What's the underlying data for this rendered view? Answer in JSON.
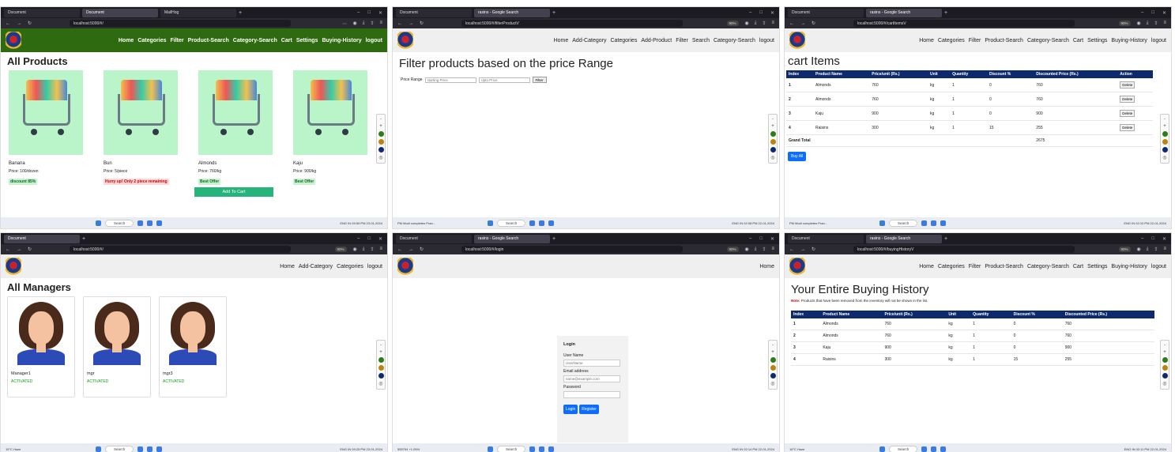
{
  "panels": [
    {
      "tabs": [
        "Document",
        "Document",
        "MailHog"
      ],
      "url": "localhost:5000/#/",
      "zoom": "",
      "nav": [
        "Home",
        "Categories",
        "Filter",
        "Product-Search",
        "Category-Search",
        "Cart",
        "Settings",
        "Buying-History",
        "logout"
      ]
    },
    {
      "tabs": [
        "Document",
        "rasins - Google Search"
      ],
      "url": "localhost:5000/#/filterProductV",
      "zoom": "90%",
      "nav": [
        "Home",
        "Add-Category",
        "Categories",
        "Add-Product",
        "Filter",
        "Search",
        "Category-Search",
        "logout"
      ]
    },
    {
      "tabs": [
        "Document",
        "rasins - Google Search"
      ],
      "url": "localhost:5000/#/cartItemsV",
      "zoom": "90%",
      "nav": [
        "Home",
        "Categories",
        "Filter",
        "Product-Search",
        "Category-Search",
        "Cart",
        "Settings",
        "Buying-History",
        "logout"
      ]
    },
    {
      "tabs": [
        "Document"
      ],
      "url": "localhost:5000/#/",
      "zoom": "90%",
      "nav": [
        "Home",
        "Add-Category",
        "Categories",
        "logout"
      ]
    },
    {
      "tabs": [
        "Document",
        "rasins - Google Search"
      ],
      "url": "localhost:5000/#/login",
      "zoom": "90%",
      "nav": [
        "Home"
      ]
    },
    {
      "tabs": [
        "Document",
        "rasins - Google Search"
      ],
      "url": "localhost:5000/#/buyingHistoryV",
      "zoom": "90%",
      "nav": [
        "Home",
        "Categories",
        "Filter",
        "Product-Search",
        "Category-Search",
        "Cart",
        "Settings",
        "Buying-History",
        "logout"
      ]
    }
  ],
  "products": {
    "title": "All Products",
    "items": [
      {
        "name": "Banana",
        "price": "Price: 100/dozen",
        "badge": "discount 85%",
        "badge_type": "green"
      },
      {
        "name": "Bun",
        "price": "Price: 5/piece",
        "badge": "Hurry up! Only 2 piece remaining",
        "badge_type": "red"
      },
      {
        "name": "Almonds",
        "price": "Price: 760/kg",
        "badge": "Best Offer",
        "badge_type": "green"
      },
      {
        "name": "Kaju",
        "price": "Price: 900/kg",
        "badge": "Best Offer",
        "badge_type": "green"
      }
    ],
    "add_to_cart": "Add To Cart"
  },
  "filter": {
    "title": "Filter products based on the price Range",
    "label": "Price Range",
    "start_placeholder": "starting Price",
    "end_placeholder": "Upto Price",
    "button": "Filter"
  },
  "cart": {
    "title": "cart Items",
    "headers": [
      "Index",
      "Product Name",
      "Price/unit (Rs.)",
      "Unit",
      "Quantity",
      "Discount %",
      "Discounted Price (Rs.)",
      "Action"
    ],
    "rows": [
      [
        "1",
        "Almonds",
        "760",
        "kg",
        "1",
        "0",
        "760"
      ],
      [
        "2",
        "Almonds",
        "760",
        "kg",
        "1",
        "0",
        "760"
      ],
      [
        "3",
        "Kaju",
        "900",
        "kg",
        "1",
        "0",
        "900"
      ],
      [
        "4",
        "Raisins",
        "300",
        "kg",
        "1",
        "15",
        "255"
      ]
    ],
    "delete": "Delete",
    "grand_label": "Grand Total",
    "grand_value": "2675",
    "buy_all": "Buy All"
  },
  "managers": {
    "title": "All Managers",
    "items": [
      {
        "name": "Manager1",
        "status": "ACTIVATED"
      },
      {
        "name": "mgr",
        "status": "ACTIVATED"
      },
      {
        "name": "mgr3",
        "status": "ACTIVATED"
      }
    ]
  },
  "login": {
    "title": "Login",
    "user_label": "User Name",
    "user_placeholder": "UserName",
    "email_label": "Email address",
    "email_placeholder": "name@example.com",
    "password_label": "Password",
    "login_btn": "Login",
    "register_btn": "Register"
  },
  "history": {
    "title": "Your Entire Buying History",
    "note_label": "Note:",
    "note_text": "Products that have been removed from the inventory will not be shown in the list.",
    "headers": [
      "Index",
      "Product Name",
      "Price/unit (Rs.)",
      "Unit",
      "Quantity",
      "Discount %",
      "Discounted Price (Rs.)"
    ],
    "rows": [
      [
        "1",
        "Almonds",
        "760",
        "kg",
        "1",
        "0",
        "760"
      ],
      [
        "2",
        "Almonds",
        "760",
        "kg",
        "1",
        "0",
        "760"
      ],
      [
        "3",
        "Kaju",
        "900",
        "kg",
        "1",
        "0",
        "900"
      ],
      [
        "4",
        "Raisins",
        "300",
        "kg",
        "1",
        "15",
        "255"
      ]
    ]
  },
  "taskbars": [
    {
      "left": "",
      "time": "09:59 PM",
      "date": "23-01-2024"
    },
    {
      "left": "PM Modi completes Pran...",
      "time": "02:08 PM",
      "date": "22-01-2024"
    },
    {
      "left": "PM Modi completes Pran...",
      "time": "02:10 PM",
      "date": "22-01-2024"
    },
    {
      "left": "15°C Haze",
      "time": "09:25 PM",
      "date": "23-01-2024"
    },
    {
      "left": "555754 +1.05%",
      "time": "02:14 PM",
      "date": "22-01-2024"
    },
    {
      "left": "16°C Haze",
      "time": "02:11 PM",
      "date": "22-01-2024"
    }
  ],
  "taskbar_search": "Search",
  "tray_lang": "ENG IN",
  "dock_colors": [
    "#2e7d1a",
    "#b8860b",
    "#0e2a6e"
  ]
}
